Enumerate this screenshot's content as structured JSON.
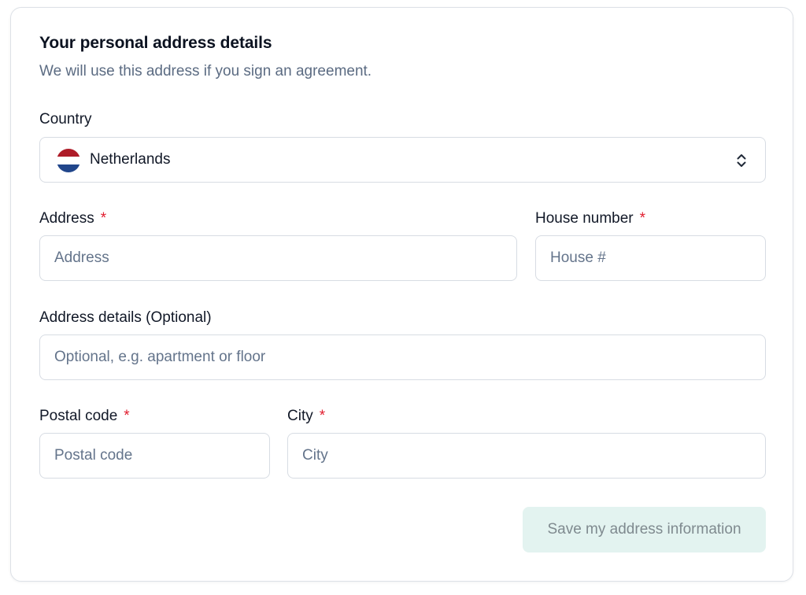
{
  "header": {
    "title": "Your personal address details",
    "subtitle": "We will use this address if you sign an agreement."
  },
  "country": {
    "label": "Country",
    "value": "Netherlands",
    "flag_colors": [
      "#ae1c28",
      "#ffffff",
      "#21468b"
    ]
  },
  "address": {
    "label": "Address",
    "required_mark": "*",
    "placeholder": "Address",
    "value": ""
  },
  "house_number": {
    "label": "House number",
    "required_mark": "*",
    "placeholder": "House #",
    "value": ""
  },
  "address_details": {
    "label": "Address details (Optional)",
    "placeholder": "Optional, e.g. apartment or floor",
    "value": ""
  },
  "postal_code": {
    "label": "Postal code",
    "required_mark": "*",
    "placeholder": "Postal code",
    "value": ""
  },
  "city": {
    "label": "City",
    "required_mark": "*",
    "placeholder": "City",
    "value": ""
  },
  "actions": {
    "save_label": "Save my address information",
    "save_disabled": true
  },
  "colors": {
    "required": "#e11d2e",
    "button_bg_disabled": "#e3f3f0",
    "subtitle": "#5b6b82"
  }
}
